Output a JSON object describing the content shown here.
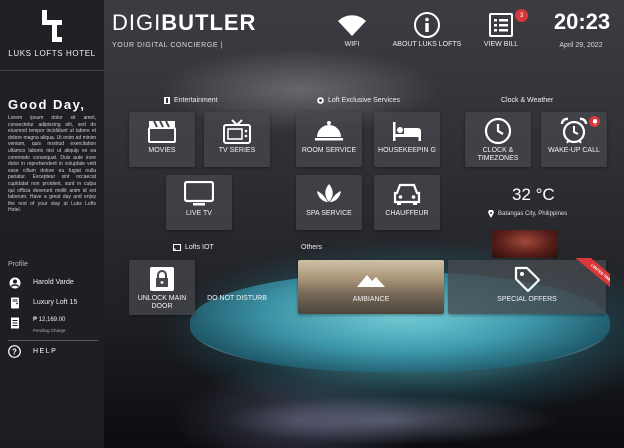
{
  "sidebar": {
    "brand": "LUKS LOFTS HOTEL",
    "greeting": "Good Day,",
    "message": "Lorem ipsum dolor sit amet, consectetur adipiscing elit, sed do eiusmod tempor incididunt ut labore et dolore magna aliqua. Ut enim ad minim veniam, quis nostrud exercitation ullamco laboris nisi ut aliquip ex ea commodo consequat. Duis aute irure dolor in reprehenderit in voluptate velit esse cillum dolore eu fugiat nulla pariatur. Excepteur sint occaecat cupidatat non proident, sunt in culpa qui officia deserunt mollit anim id est laborum. Have a great day and enjoy the rest of your stay at Luks Lofts Hotel.",
    "profile_label": "Profile",
    "guest_name": "Harold Varde",
    "room": "Luxury Loft 15",
    "amount": "₱ 12,169.00",
    "amount_note": "Pending Charge",
    "help": "HELP"
  },
  "header": {
    "title_light": "DIGI",
    "title_bold": "BUTLER",
    "subtitle": "YOUR DIGITAL CONCIERGE |",
    "wifi": "WIFI",
    "about": "ABOUT LUKS LOFTS",
    "bill": "VIEW BILL",
    "bill_badge": "3",
    "time": "20:23",
    "date": "April 29, 2022"
  },
  "sections": {
    "entertainment": "Entertainment",
    "services": "Loft Exclusive Services",
    "clock_weather": "Clock & Weather",
    "iot": "Lofts IOT",
    "others": "Others"
  },
  "tiles": {
    "movies": "MOVIES",
    "tv_series": "TV SERIES",
    "room_service": "ROOM SERVICE",
    "housekeeping": "HOUSEKEEPIN G",
    "clock_timezones": "CLOCK & TIMEZONES",
    "wake_up": "WAKE-UP CALL",
    "live_tv": "LIVE TV",
    "spa": "SPA SERVICE",
    "chauffeur": "CHAUFFEUR",
    "unlock": "UNLOCK MAIN DOOR",
    "dnd": "DO NOT DISTURB",
    "ambiance": "AMBIANCE",
    "offers": "SPECIAL OFFERS",
    "ribbon": "LIMITED TIME"
  },
  "weather": {
    "temp": "32 °C",
    "location": "Batangas City, Philippines"
  },
  "colors": {
    "accent_red": "#d9383a",
    "tile_bg": "#46484e",
    "sidebar_bg": "#1e1f23"
  }
}
